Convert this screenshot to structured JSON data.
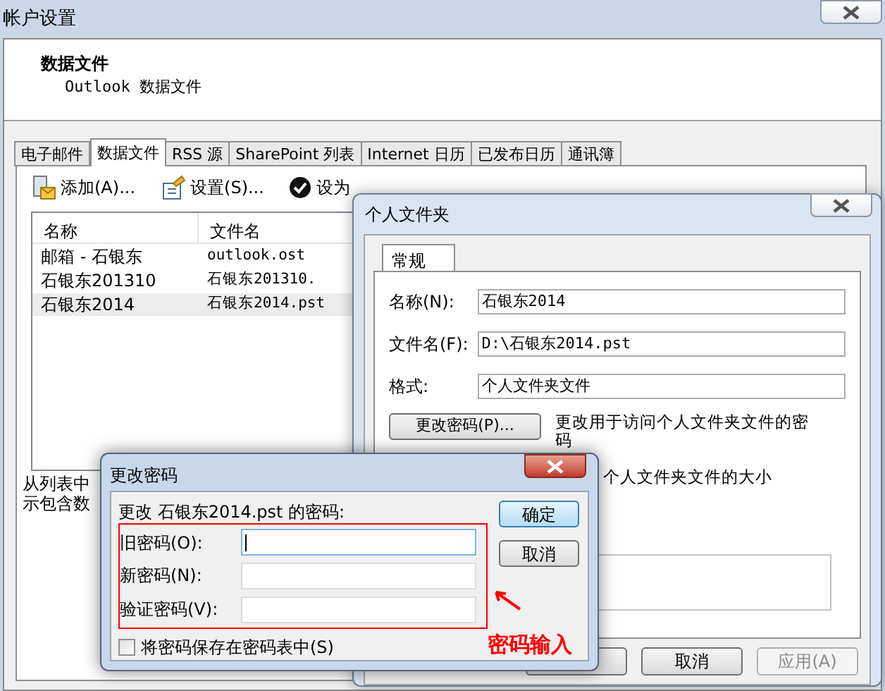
{
  "main_window": {
    "title": "帐户设置",
    "header_title": "数据文件",
    "header_subtitle": "Outlook 数据文件",
    "tabs": [
      {
        "label": "电子邮件",
        "selected": false
      },
      {
        "label": "数据文件",
        "selected": true
      },
      {
        "label": "RSS 源",
        "selected": false
      },
      {
        "label": "SharePoint 列表",
        "selected": false
      },
      {
        "label": "Internet 日历",
        "selected": false
      },
      {
        "label": "已发布日历",
        "selected": false
      },
      {
        "label": "通讯簿",
        "selected": false
      }
    ],
    "toolbar": [
      {
        "label": "添加(A)...",
        "kind": "add"
      },
      {
        "label": "设置(S)...",
        "kind": "settings"
      },
      {
        "label": "设为",
        "kind": "check"
      }
    ],
    "table": {
      "columns": [
        "名称",
        "文件名"
      ],
      "rows": [
        {
          "cells": [
            "邮箱 - 石银东",
            "outlook.ost"
          ],
          "selected": false
        },
        {
          "cells": [
            "石银东201310",
            "石银东201310."
          ],
          "selected": false
        },
        {
          "cells": [
            "石银东2014",
            "石银东2014.pst"
          ],
          "selected": true
        }
      ]
    },
    "hint_lines": [
      "从列表中",
      "示包含数"
    ]
  },
  "folder_dialog": {
    "title": "个人文件夹",
    "tab": "常规",
    "fields": [
      {
        "label": "名称(N):",
        "value": "石银东2014"
      },
      {
        "label": "文件名(F):",
        "value": "D:\\石银东2014.pst"
      },
      {
        "label": "格式:",
        "value": "个人文件夹文件"
      }
    ],
    "change_password_button": "更改密码(P)...",
    "change_password_description": "更改用于访问个人文件夹文件的密码",
    "compact_description": "个人文件夹文件的大小",
    "buttons": [
      {
        "label": "取消",
        "disabled": false
      },
      {
        "label": "应用(A)",
        "disabled": true
      }
    ]
  },
  "password_dialog": {
    "title": "更改密码",
    "prompt": "更改 石银东2014.pst 的密码:",
    "fields": [
      {
        "label": "旧密码(O):",
        "focused": true
      },
      {
        "label": "新密码(N):",
        "focused": false
      },
      {
        "label": "验证密码(V):",
        "focused": false
      }
    ],
    "ok_button": "确定",
    "cancel_button": "取消",
    "save_checkbox": {
      "label": "将密码保存在密码表中(S)",
      "checked": false
    },
    "annotation": "密码输入"
  }
}
